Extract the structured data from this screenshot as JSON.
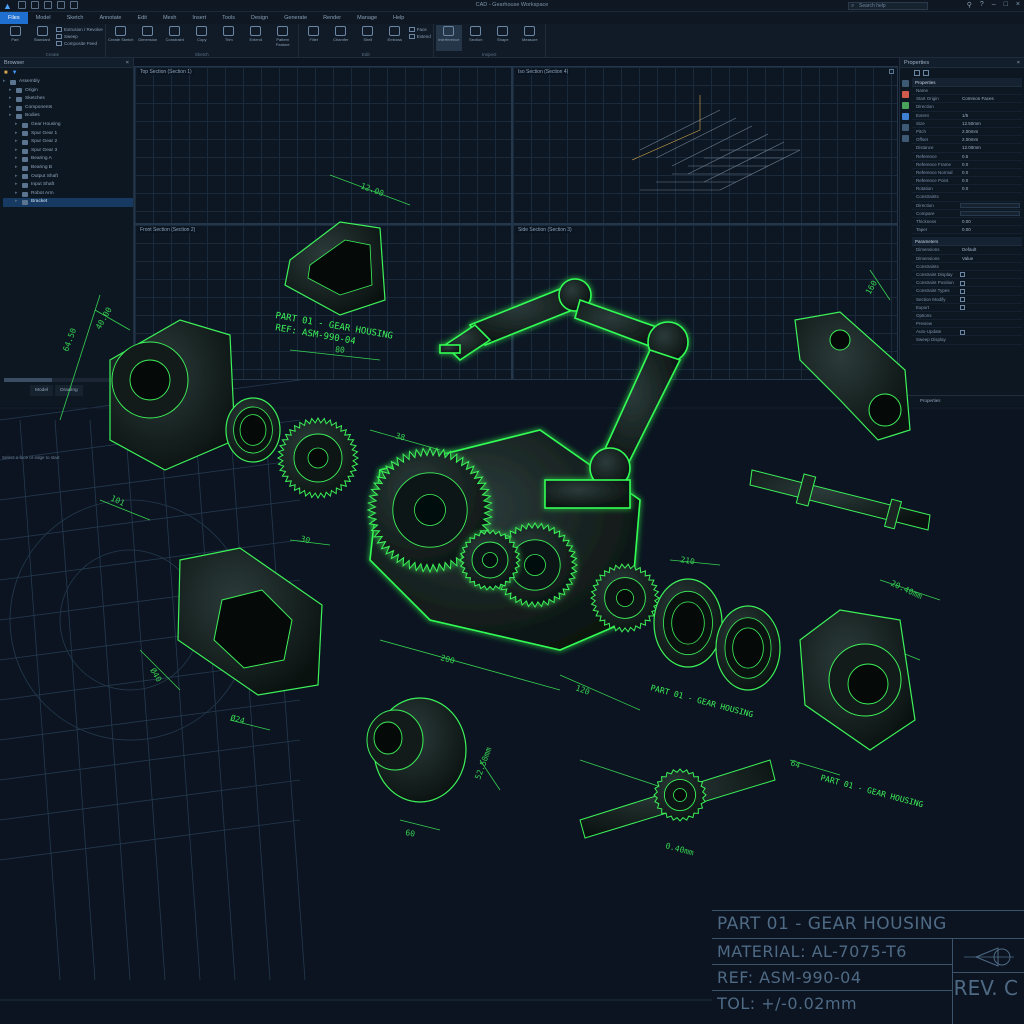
{
  "app": {
    "title": "CAD - Gearhouse Workspace",
    "search_placeholder": "Search help",
    "menu": [
      "Files",
      "Model",
      "Sketch",
      "Annotate",
      "Edit",
      "Mesh",
      "Insert",
      "Tools",
      "Design",
      "Generate",
      "Render",
      "Manage",
      "Help"
    ],
    "active_menu_index": 0
  },
  "ribbon": {
    "groups": [
      {
        "name": "Create",
        "buttons": [
          "Part",
          "Standard"
        ],
        "small": [
          "Extrusion / Revolve",
          "Sweep",
          "Composite Feed"
        ]
      },
      {
        "name": "Sketch",
        "buttons": [
          "Create Sketch",
          "Dimension",
          "Constraint",
          "Copy",
          "Trim",
          "Extend",
          "Pattern Feature"
        ],
        "small": []
      },
      {
        "name": "Edit",
        "buttons": [
          "Fillet",
          "Chamfer",
          "Shell",
          "Emboss"
        ],
        "small": [
          "Face",
          "Extend"
        ]
      },
      {
        "name": "Inspect",
        "buttons": [
          "Interference",
          "Section",
          "Shape",
          "Measure"
        ],
        "small": []
      }
    ]
  },
  "browser": {
    "title": "Browser",
    "tree": [
      {
        "label": "Assembly",
        "level": 0,
        "selected": false
      },
      {
        "label": "Origin",
        "level": 1,
        "selected": false
      },
      {
        "label": "Sketches",
        "level": 1,
        "selected": false
      },
      {
        "label": "Components",
        "level": 1,
        "selected": false
      },
      {
        "label": "Bodies",
        "level": 1,
        "selected": false
      },
      {
        "label": "Gear Housing",
        "level": 2,
        "selected": false
      },
      {
        "label": "Spur Gear 1",
        "level": 2,
        "selected": false
      },
      {
        "label": "Spur Gear 2",
        "level": 2,
        "selected": false
      },
      {
        "label": "Spur Gear 3",
        "level": 2,
        "selected": false
      },
      {
        "label": "Bearing A",
        "level": 2,
        "selected": false
      },
      {
        "label": "Bearing B",
        "level": 2,
        "selected": false
      },
      {
        "label": "Output Shaft",
        "level": 2,
        "selected": false
      },
      {
        "label": "Input Shaft",
        "level": 2,
        "selected": false
      },
      {
        "label": "Robot Arm",
        "level": 2,
        "selected": false
      },
      {
        "label": "Bracket",
        "level": 2,
        "selected": true
      }
    ],
    "tabs": [
      "Model",
      "Drawing"
    ],
    "status": "Select a face or edge to start"
  },
  "viewports": {
    "top_left": "Top Section (Section 1)",
    "top_center": "Front Section (Section 2)",
    "bottom_center": "Side Section (Section 3)",
    "top_right": "Iso Section (Section 4)"
  },
  "properties": {
    "title": "Properties",
    "section1": "Properties",
    "rows": [
      {
        "k": "Name",
        "v": ""
      },
      {
        "k": "Start Origin",
        "v": "Common Faces"
      },
      {
        "k": "Direction",
        "v": ""
      },
      {
        "k": "Extent",
        "v": "1/5"
      },
      {
        "k": "Size",
        "v": "12.50mm"
      },
      {
        "k": "Pitch",
        "v": "2.00mm"
      },
      {
        "k": "Offset",
        "v": "2.00mm"
      },
      {
        "k": "Distance",
        "v": "12.00mm"
      },
      {
        "k": "Reference",
        "v": "0.5"
      },
      {
        "k": "Reference Frame",
        "v": "0.0"
      },
      {
        "k": "Reference Normal",
        "v": "0.0"
      },
      {
        "k": "Reference Point",
        "v": "0.0"
      },
      {
        "k": "Rotation",
        "v": "0.0"
      },
      {
        "k": "Constraints",
        "v": ""
      },
      {
        "k": "Direction",
        "v": "box"
      },
      {
        "k": "Compare",
        "v": "box"
      },
      {
        "k": "Thickness",
        "v": "0.00"
      },
      {
        "k": "Taper",
        "v": "0.00"
      }
    ],
    "section2": "Parameters",
    "rows2": [
      {
        "k": "Dimensions",
        "v": "Default"
      },
      {
        "k": "Dimensions",
        "v": "Value"
      },
      {
        "k": "Constraints",
        "v": ""
      },
      {
        "k": "Constraint Display",
        "v": "check"
      },
      {
        "k": "Constraint Position",
        "v": "check"
      },
      {
        "k": "Constraint Types",
        "v": "check"
      },
      {
        "k": "Section Modify",
        "v": "check"
      },
      {
        "k": "Export",
        "v": "check"
      },
      {
        "k": "Options",
        "v": ""
      },
      {
        "k": "Preview",
        "v": ""
      },
      {
        "k": "Auto-Update",
        "v": "check"
      },
      {
        "k": "Sweep Display",
        "v": ""
      }
    ],
    "tabs": "Properties"
  },
  "drawing": {
    "callouts": [
      "PART 01 - GEAR HOUSING",
      "REF: ASM-990-04"
    ],
    "dims": [
      "12.00",
      "64.50",
      "40.00",
      "101",
      "80",
      "30",
      "38",
      "200",
      "120",
      "Ø40",
      "Ø24",
      "250",
      "210",
      "160",
      "Ø50",
      "Ø12",
      "51",
      "20.40mm",
      "52.50mm",
      "0.40mm",
      "64",
      "60"
    ],
    "part_label_2": "PART 01 - GEAR HOUSING",
    "part_label_3": "PART 01 - GEAR HOUSING"
  },
  "titleblock": {
    "line1": "PART 01 - GEAR HOUSING",
    "line2": "MATERIAL: AL-7075-T6",
    "line3": "REF: ASM-990-04",
    "line4": "TOL: +/-0.02mm",
    "rev": "REV. C"
  },
  "colors": {
    "accent": "#3df25a",
    "glow": "#33ff55",
    "bg": "#0b1420",
    "line": "#2f4a63",
    "highlight": "#1f6fd1"
  }
}
